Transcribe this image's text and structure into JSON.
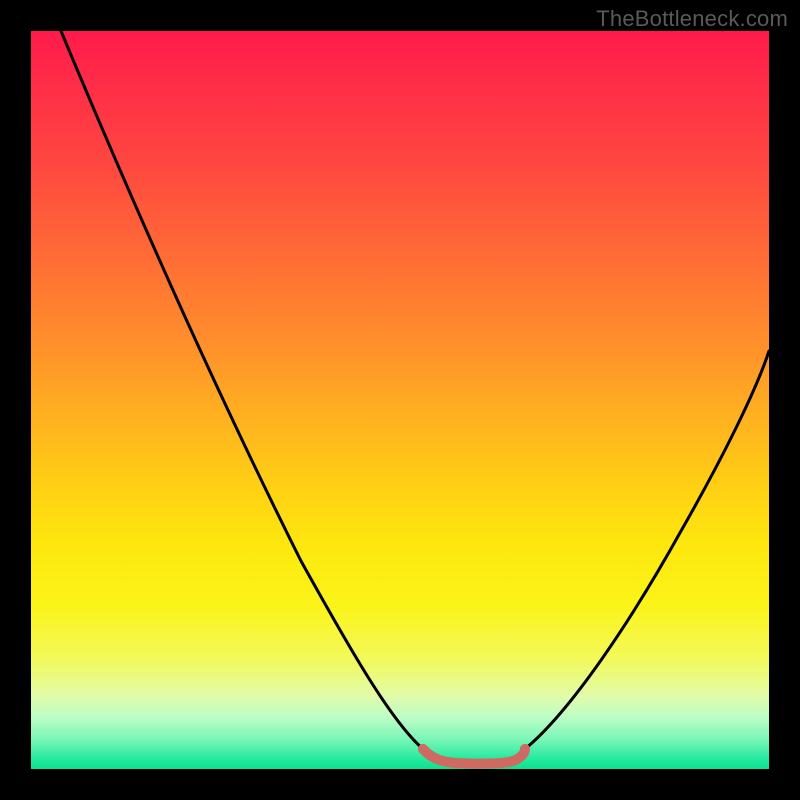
{
  "watermark": "TheBottleneck.com",
  "chart_data": {
    "type": "line",
    "title": "",
    "xlabel": "",
    "ylabel": "",
    "xlim": [
      0,
      100
    ],
    "ylim": [
      0,
      100
    ],
    "grid": false,
    "legend": false,
    "notes": "Bottleneck-style V-curve plotted over a vertical red→yellow→green gradient. The left black curve descends steeply from the top-left toward a flat minimum near x≈55–65, joined by a thicker muted-red segment along the trough, then a black curve rises to the right edge. Y-values here represent vertical position (0 = bottom / green, 100 = top / red). Values are visual estimates — the source image has no axis ticks or numeric labels.",
    "series": [
      {
        "name": "left-curve",
        "color": "#000000",
        "x": [
          4,
          10,
          16,
          22,
          28,
          34,
          40,
          46,
          50,
          53
        ],
        "y": [
          100,
          88,
          76,
          64,
          52,
          40,
          28,
          16,
          8,
          3
        ]
      },
      {
        "name": "trough-highlight",
        "color": "#cf6a63",
        "x": [
          53,
          55,
          57,
          59,
          61,
          63,
          65,
          67
        ],
        "y": [
          3,
          1.2,
          0.8,
          0.8,
          0.8,
          0.9,
          1.4,
          3
        ]
      },
      {
        "name": "right-curve",
        "color": "#000000",
        "x": [
          67,
          72,
          78,
          84,
          90,
          96,
          100
        ],
        "y": [
          3,
          9,
          18,
          28,
          39,
          50,
          57
        ]
      }
    ],
    "background_gradient_stops": [
      {
        "pos": 0.0,
        "color": "#ff1a4b"
      },
      {
        "pos": 0.3,
        "color": "#ff6a36"
      },
      {
        "pos": 0.62,
        "color": "#ffd114"
      },
      {
        "pos": 0.85,
        "color": "#f3f95a"
      },
      {
        "pos": 1.0,
        "color": "#0be28e"
      }
    ]
  }
}
